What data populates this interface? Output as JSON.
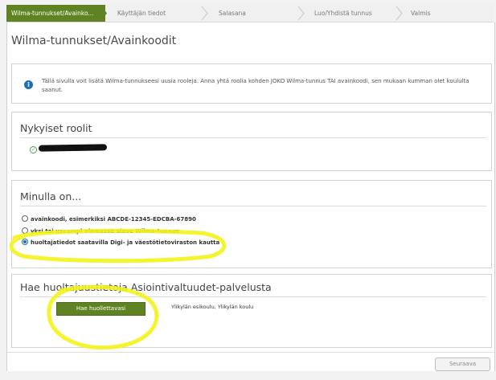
{
  "wizard": {
    "steps": [
      {
        "label": "Wilma-tunnukset/Avainko..."
      },
      {
        "label": "Käyttäjän tiedot"
      },
      {
        "label": "Salasana"
      },
      {
        "label": "Luo/Yhdistä tunnus"
      },
      {
        "label": "Valmis"
      }
    ]
  },
  "page": {
    "title": "Wilma-tunnukset/Avainkoodit",
    "info_text": "Tällä sivulla voit lisätä Wilma-tunnukseesi uusia rooleja. Anna yhtä roolia kohden JOKO Wilma-tunnus TAI avainkoodi, sen mukaan kumman olet koululta saanut."
  },
  "current_roles": {
    "title": "Nykyiset roolit"
  },
  "minulla_on": {
    "title": "Minulla on...",
    "options": [
      {
        "label": "avainkoodi, esimerkiksi ABCDE-12345-EDCBA-67890",
        "selected": false
      },
      {
        "label": "yksi tai useampi olemassa oleva Wilma-tunnus",
        "selected": false
      },
      {
        "label": "huoltajatiedot saatavilla Digi- ja väestötietoviraston kautta",
        "selected": true
      }
    ]
  },
  "fetch": {
    "title": "Hae huoltajuustietoja Asiointivaltuudet-palvelusta",
    "button_label": "Hae huollettavasi",
    "school_text": "Ylikylän esikoulu, Ylikylän koulu"
  },
  "footer": {
    "next_label": "Seuraava"
  },
  "colors": {
    "accent_green": "#5f8222",
    "info_blue": "#1f6fb2",
    "annotation_yellow": "#f3f31a"
  }
}
